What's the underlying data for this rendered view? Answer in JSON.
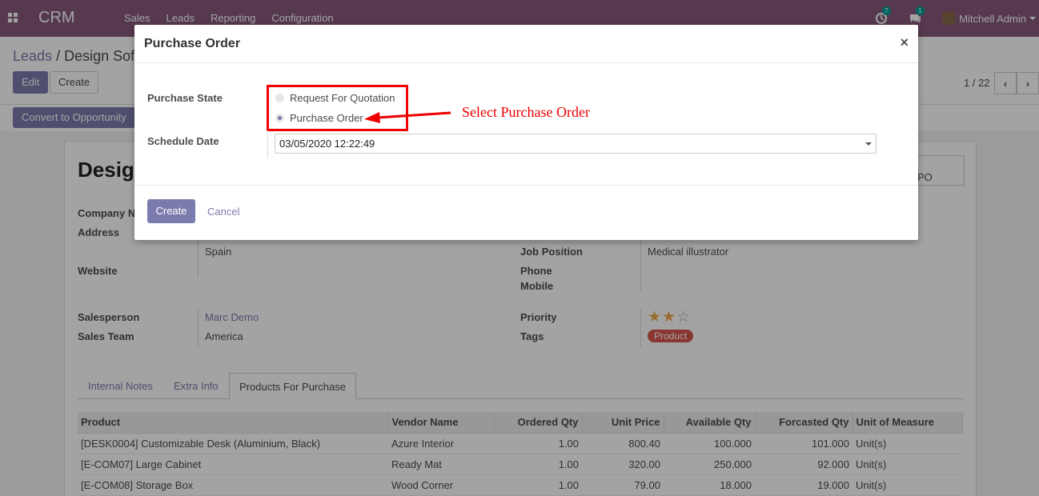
{
  "topbar": {
    "app_name": "CRM",
    "menu": [
      "Sales",
      "Leads",
      "Reporting",
      "Configuration"
    ],
    "activity_count": "7",
    "message_count": "1",
    "user_name": "Mitchell Admin"
  },
  "control_panel": {
    "breadcrumb_root": "Leads",
    "breadcrumb_sep": "/",
    "breadcrumb_current": "Design Sof",
    "edit_label": "Edit",
    "create_label": "Create",
    "pager": "1 / 22",
    "convert_label": "Convert to Opportunity"
  },
  "record": {
    "title": "Desig",
    "po_box_text": "PO",
    "company_label": "Company N",
    "address_label": "Address",
    "address_country": "Spain",
    "website_label": "Website",
    "salesperson_label": "Salesperson",
    "salesperson_value": "Marc Demo",
    "sales_team_label": "Sales Team",
    "sales_team_value": "America",
    "job_position_label": "Job Position",
    "job_position_value": "Medical illustrator",
    "phone_label": "Phone",
    "mobile_label": "Mobile",
    "priority_label": "Priority",
    "priority_stars": 2,
    "priority_max": 3,
    "tags_label": "Tags",
    "tag_value": "Product"
  },
  "tabs": [
    {
      "label": "Internal Notes"
    },
    {
      "label": "Extra Info"
    },
    {
      "label": "Products For Purchase"
    }
  ],
  "products_table": {
    "columns": [
      "Product",
      "Vendor Name",
      "Ordered Qty",
      "Unit Price",
      "Available Qty",
      "Forcasted Qty",
      "Unit of Measure"
    ],
    "rows": [
      [
        "[DESK0004] Customizable Desk (Aluminium, Black)",
        "Azure Interior",
        "1.00",
        "800.40",
        "100.000",
        "101.000",
        "Unit(s)"
      ],
      [
        "[E-COM07] Large Cabinet",
        "Ready Mat",
        "1.00",
        "320.00",
        "250.000",
        "92.000",
        "Unit(s)"
      ],
      [
        "[E-COM08] Storage Box",
        "Wood Corner",
        "1.00",
        "79.00",
        "18.000",
        "19.000",
        "Unit(s)"
      ]
    ]
  },
  "modal": {
    "title": "Purchase Order",
    "close": "×",
    "purchase_state_label": "Purchase State",
    "option_rfq": "Request For Quotation",
    "option_po": "Purchase Order",
    "schedule_date_label": "Schedule Date",
    "schedule_date_value": "03/05/2020 12:22:49",
    "create_label": "Create",
    "cancel_label": "Cancel"
  },
  "annotation": {
    "text": "Select Purchase Order",
    "color": "#e00000"
  },
  "colors": {
    "brand": "#875a7b",
    "primary": "#7c7bad",
    "tag": "#d9534f",
    "star": "#f0ad4e"
  }
}
